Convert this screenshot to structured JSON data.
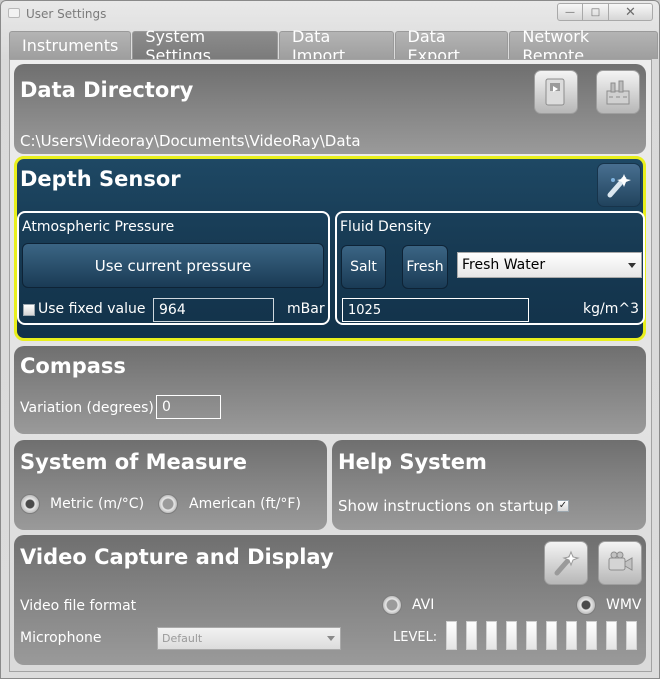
{
  "window": {
    "title": "User Settings"
  },
  "tabs": [
    {
      "label": "Instruments"
    },
    {
      "label": "System Settings"
    },
    {
      "label": "Data Import"
    },
    {
      "label": "Data Export"
    },
    {
      "label": "Network Remote"
    }
  ],
  "data_directory": {
    "title": "Data Directory",
    "path": "C:\\Users\\Videoray\\Documents\\VideoRay\\Data"
  },
  "depth_sensor": {
    "title": "Depth Sensor",
    "atmospheric": {
      "title": "Atmospheric Pressure",
      "use_current_label": "Use current pressure",
      "use_fixed_label": "Use fixed value",
      "value": "964",
      "unit": "mBar",
      "use_fixed_checked": false
    },
    "fluid": {
      "title": "Fluid Density",
      "salt_label": "Salt",
      "fresh_label": "Fresh",
      "selected": "Fresh Water",
      "value": "1025",
      "unit": "kg/m^3"
    }
  },
  "compass": {
    "title": "Compass",
    "variation_label": "Variation (degrees)",
    "variation_value": "0"
  },
  "measure": {
    "title": "System of Measure",
    "metric_label": "Metric (m/°C)",
    "american_label": "American (ft/°F)",
    "selected": "metric"
  },
  "help": {
    "title": "Help System",
    "show_label": "Show instructions on startup",
    "show_checked": true
  },
  "video": {
    "title": "Video Capture and Display",
    "format_label": "Video file format",
    "avi_label": "AVI",
    "wmv_label": "WMV",
    "selected_format": "WMV",
    "microphone_label": "Microphone",
    "microphone_value": "Default",
    "level_label": "LEVEL:"
  },
  "colors": {
    "highlight_border": "#e8ef1c",
    "depth_panel": "#173a53"
  }
}
